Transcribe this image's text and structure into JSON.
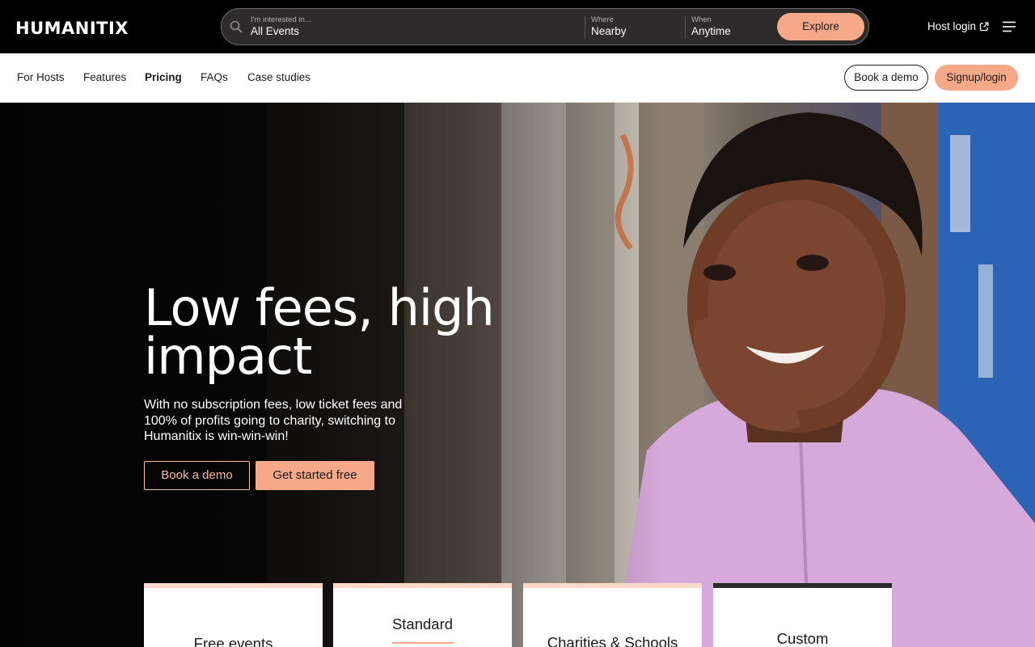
{
  "brand": {
    "logo_text": "HUMANITIX",
    "accent_color": "#f6a988"
  },
  "search": {
    "interest_label": "I'm interested in...",
    "interest_value": "All Events",
    "where_label": "Where",
    "where_value": "Nearby",
    "when_label": "When",
    "when_value": "Anytime",
    "explore_label": "Explore"
  },
  "header": {
    "host_login": "Host login",
    "menu_icon": "hamburger-icon"
  },
  "subnav": {
    "links": [
      "For Hosts",
      "Features",
      "Pricing",
      "FAQs",
      "Case studies"
    ],
    "active": "Pricing",
    "book_demo": "Book a demo",
    "signup": "Signup/login"
  },
  "hero": {
    "title": "Low fees, high impact",
    "subtitle": "With no subscription fees, low ticket fees and 100% of profits going to charity, switching to Humanitix is win-win-win!",
    "book_demo": "Book a demo",
    "get_started": "Get started free"
  },
  "pricing_cards": [
    {
      "title": "Free events"
    },
    {
      "title": "Standard"
    },
    {
      "title": "Charities & Schools"
    },
    {
      "title": "Custom"
    }
  ]
}
